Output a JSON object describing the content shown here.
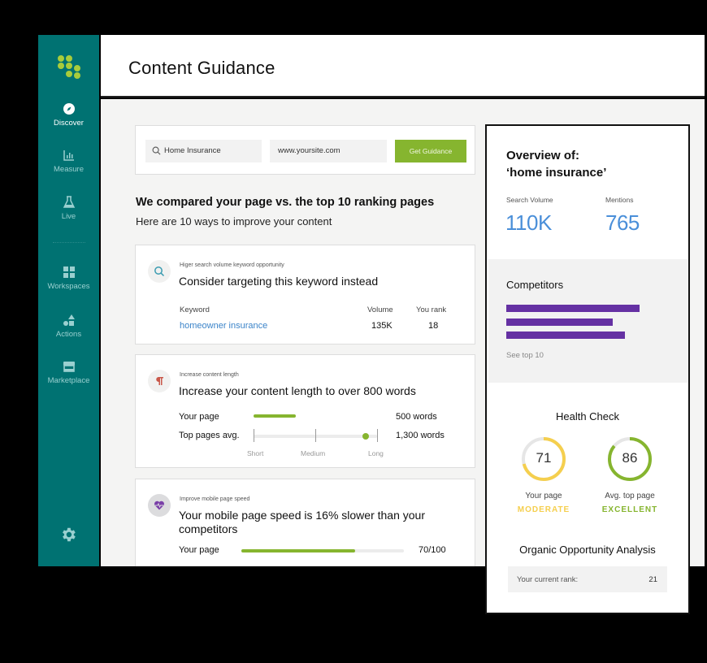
{
  "sidebar": {
    "logo": "logo-dots",
    "items": [
      {
        "label": "Discover",
        "icon": "compass-icon",
        "active": true
      },
      {
        "label": "Measure",
        "icon": "chart-icon",
        "active": false
      },
      {
        "label": "Live",
        "icon": "flask-icon",
        "active": false
      },
      {
        "label": "Workspaces",
        "icon": "grid-icon",
        "active": false
      },
      {
        "label": "Actions",
        "icon": "shapes-icon",
        "active": false
      },
      {
        "label": "Marketplace",
        "icon": "store-icon",
        "active": false
      }
    ],
    "settings_icon": "gear-icon"
  },
  "header": {
    "title": "Content Guidance"
  },
  "search": {
    "keyword_value": "Home Insurance",
    "url_value": "www.yoursite.com",
    "button_label": "Get Guidance"
  },
  "comparison": {
    "title": "We compared your page vs. the top 10 ranking pages",
    "subtitle": "Here are 10 ways to improve your content"
  },
  "cards": [
    {
      "category": "Higer search volume keyword opportunity",
      "title": "Consider targeting this keyword instead",
      "icon": "search-icon",
      "headers": {
        "keyword": "Keyword",
        "volume": "Volume",
        "rank": "You rank"
      },
      "row": {
        "keyword": "homeowner insurance",
        "volume": "135K",
        "rank": "18"
      }
    },
    {
      "category": "Increase content length",
      "title": "Increase your content length to over 800 words",
      "icon": "paragraph-icon",
      "your_page": {
        "label": "Your page",
        "value": "500 words"
      },
      "top_pages": {
        "label": "Top pages avg.",
        "value": "1,300 words"
      },
      "scale": [
        "Short",
        "Medium",
        "Long"
      ]
    },
    {
      "category": "Improve mobile page speed",
      "title_line1": "Your mobile page speed is 16% slower than your",
      "title_line2": "competitors",
      "icon": "heart-pulse-icon",
      "your_page": {
        "label": "Your page",
        "value": "70/100",
        "score": 70
      }
    }
  ],
  "overview": {
    "title_line1": "Overview of:",
    "title_line2": "‘home insurance’",
    "search_volume_label": "Search Volume",
    "search_volume": "110K",
    "mentions_label": "Mentions",
    "mentions": "765",
    "competitors": {
      "title": "Competitors",
      "bars_relative": [
        1.0,
        0.8,
        0.89
      ],
      "link": "See top 10",
      "color": "#6531a3"
    },
    "health_check": {
      "title": "Health Check",
      "gauges": [
        {
          "value": "71",
          "score": 71,
          "label": "Your page",
          "status": "MODERATE",
          "color": "#f5cf4e"
        },
        {
          "value": "86",
          "score": 86,
          "label": "Avg. top page",
          "status": "EXCELLENT",
          "color": "#86b52f"
        }
      ]
    },
    "organic": {
      "title": "Organic Opportunity Analysis",
      "rank_label": "Your current rank:",
      "rank_value": "21"
    }
  },
  "colors": {
    "sidebar": "#007272",
    "accent_green": "#86b52f",
    "link_blue": "#3b84c9",
    "metric_blue": "#4a8fd9"
  }
}
